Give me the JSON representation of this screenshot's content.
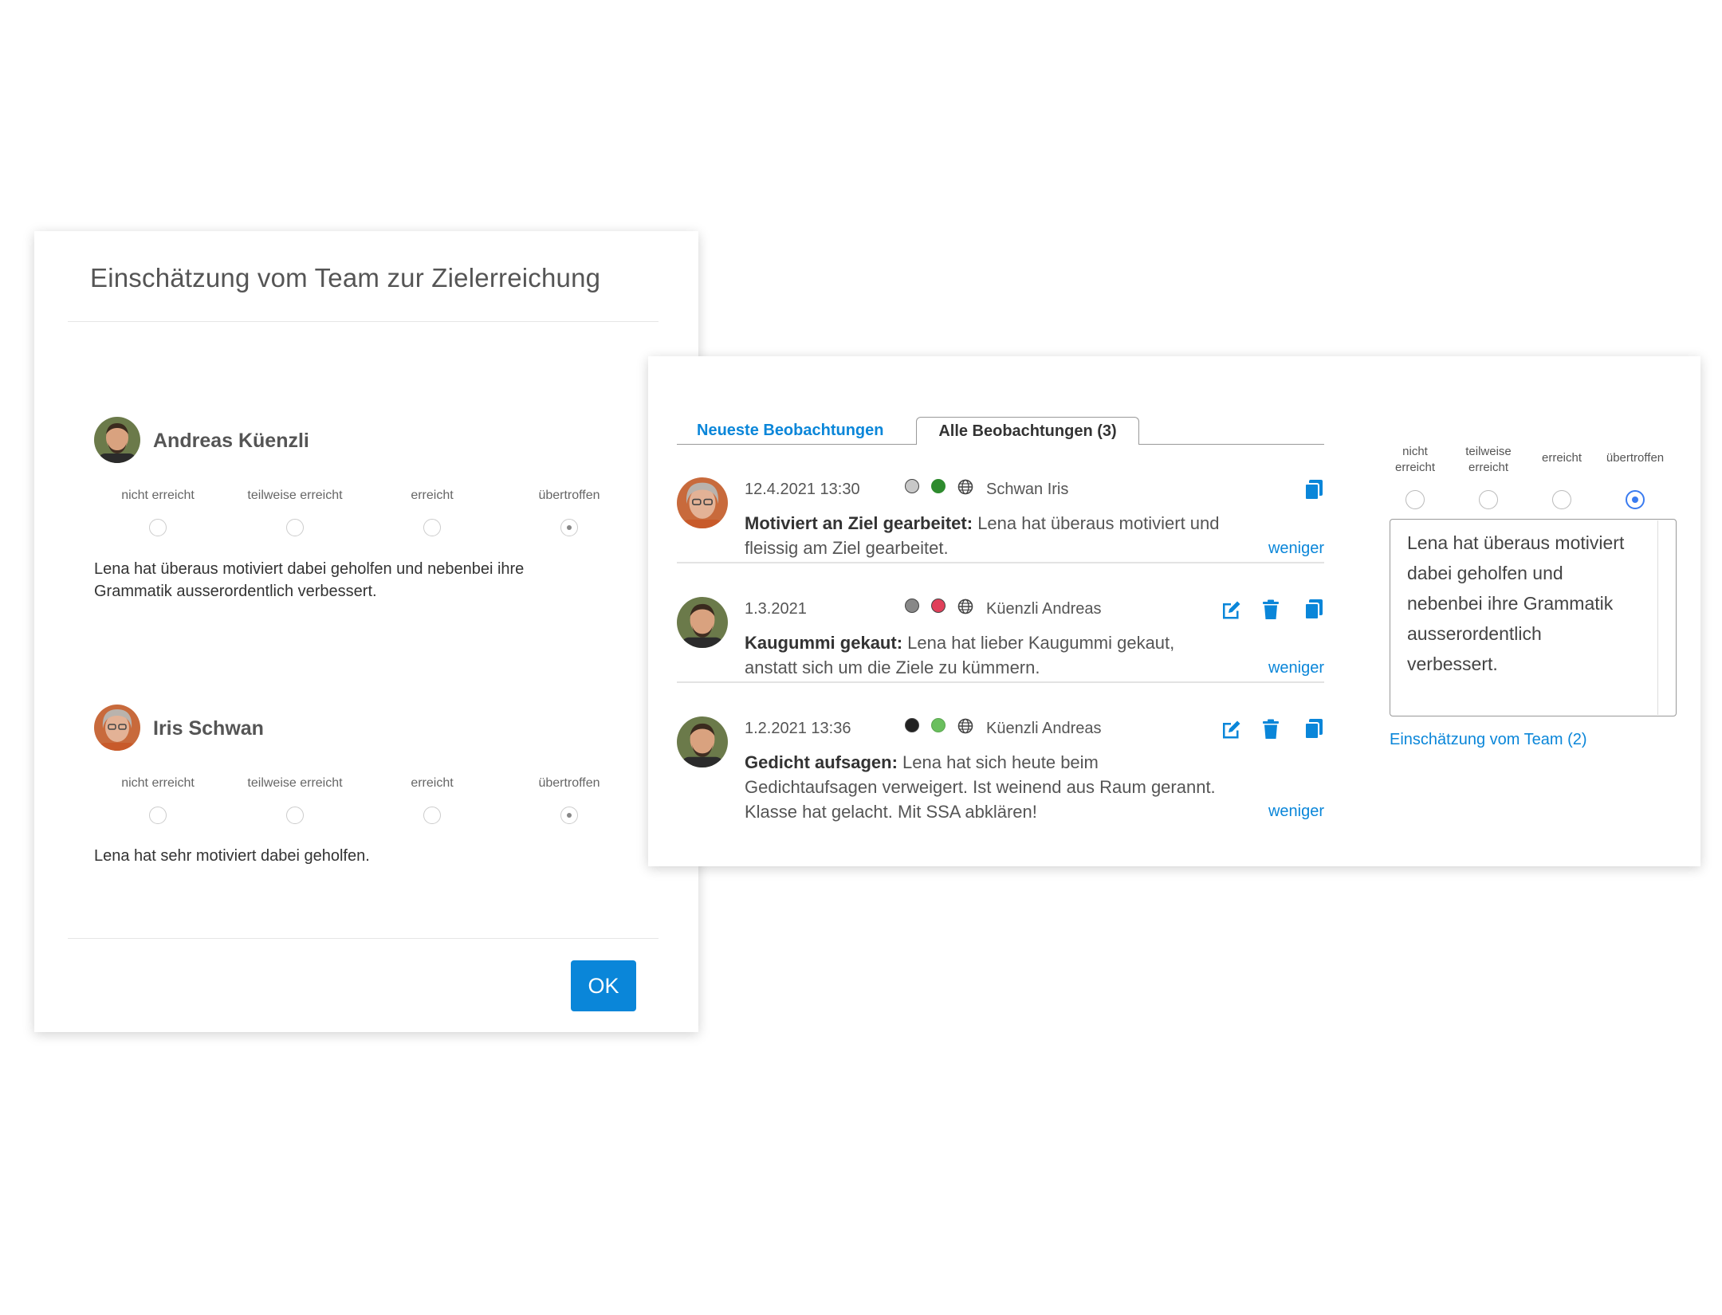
{
  "modal": {
    "title": "Einschätzung vom Team zur Zielerreichung",
    "scale_labels": [
      "nicht erreicht",
      "teilweise erreicht",
      "erreicht",
      "übertroffen"
    ],
    "people": [
      {
        "name": "Andreas Küenzli",
        "selected": 3,
        "comment": "Lena hat überaus motiviert dabei geholfen und nebenbei ihre Grammatik ausserordentlich verbessert."
      },
      {
        "name": "Iris Schwan",
        "selected": 3,
        "comment": "Lena hat sehr motiviert dabei geholfen."
      }
    ],
    "ok_label": "OK"
  },
  "panel": {
    "tabs": [
      "Neueste Beobachtungen",
      "Alle Beobachtungen (3)"
    ],
    "active_tab": 1,
    "observations": [
      {
        "date": "12.4.2021 13:30",
        "status_colors": [
          "#c8c8c8",
          "#2e8b2e"
        ],
        "author": "Schwan Iris",
        "title": "Motiviert an Ziel gearbeitet:",
        "text": "Lena hat überaus motiviert und fleissig am Ziel gearbeitet.",
        "toggle": "weniger",
        "actions": [
          "copy-icon"
        ]
      },
      {
        "date": "1.3.2021",
        "status_colors": [
          "#888888",
          "#e0405a"
        ],
        "author": "Küenzli Andreas",
        "title": "Kaugummi gekaut:",
        "text": "Lena hat lieber Kaugummi gekaut, anstatt sich um die Ziele zu kümmern.",
        "toggle": "weniger",
        "actions": [
          "edit-icon",
          "trash-icon",
          "copy-icon"
        ]
      },
      {
        "date": "1.2.2021 13:36",
        "status_colors": [
          "#222222",
          "#6abf5e"
        ],
        "author": "Küenzli Andreas",
        "title": "Gedicht aufsagen:",
        "text": "Lena hat sich heute beim Gedichtaufsagen verweigert. Ist weinend aus Raum gerannt. Klasse hat gelacht. Mit SSA abklären!",
        "toggle": "weniger",
        "actions": [
          "edit-icon",
          "trash-icon",
          "copy-icon"
        ]
      }
    ],
    "rating": {
      "labels": [
        [
          "nicht",
          "erreicht"
        ],
        [
          "teilweise",
          "erreicht"
        ],
        [
          "erreicht"
        ],
        [
          "übertroffen"
        ]
      ],
      "selected": 3,
      "comment": "Lena hat überaus motiviert dabei geholfen und nebenbei ihre Grammatik ausserordentlich verbessert.",
      "link": "Einschätzung vom Team (2)"
    }
  },
  "colors": {
    "accent": "#0a86d9",
    "radio_selected": "#3a7bf0"
  }
}
